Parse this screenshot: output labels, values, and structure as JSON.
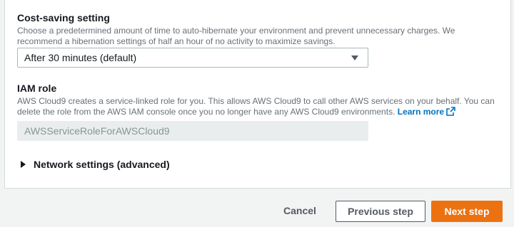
{
  "cost_saving": {
    "label": "Cost-saving setting",
    "description": "Choose a predetermined amount of time to auto-hibernate your environment and prevent unnecessary charges. We recommend a hibernation settings of half an hour of no activity to maximize savings.",
    "selected_value": "After 30 minutes (default)"
  },
  "iam_role": {
    "label": "IAM role",
    "description": "AWS Cloud9 creates a service-linked role for you. This allows AWS Cloud9 to call other AWS services on your behalf. You can delete the role from the AWS IAM console once you no longer have any AWS Cloud9 environments.",
    "learn_more": "Learn more",
    "role_name": "AWSServiceRoleForAWSCloud9"
  },
  "network": {
    "label": "Network settings (advanced)"
  },
  "footer": {
    "cancel_label": "Cancel",
    "previous_label": "Previous step",
    "next_label": "Next step"
  },
  "colors": {
    "accent": "#ec7211",
    "link": "#0073bb"
  }
}
